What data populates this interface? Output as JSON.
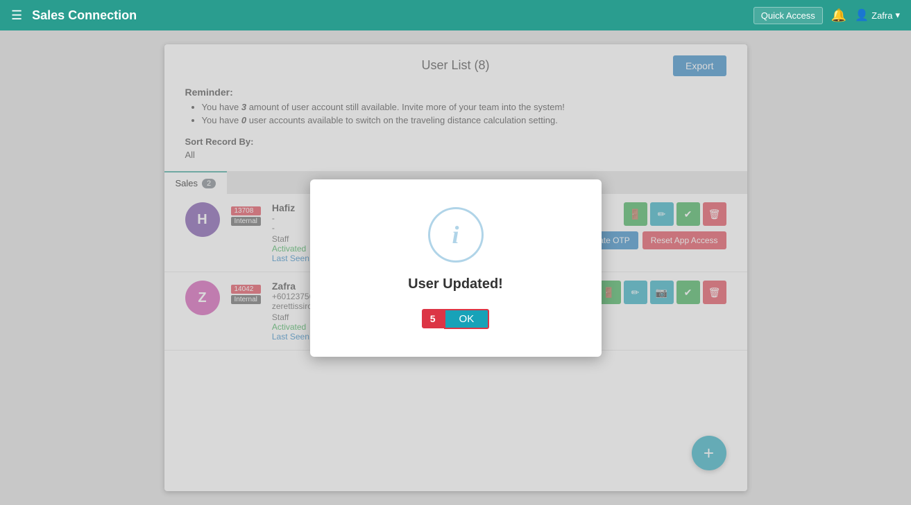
{
  "header": {
    "menu_icon": "☰",
    "title": "Sales Connection",
    "quick_access_label": "Quick Access",
    "bell_icon": "🔔",
    "user_icon": "👤",
    "user_name": "Zafra",
    "chevron_icon": "▾"
  },
  "page": {
    "title": "User List (8)",
    "export_label": "Export"
  },
  "reminder": {
    "title": "Reminder:",
    "lines": [
      "You have 3 amount of user account still available. Invite more of your team into the system!",
      "You have 0 user accounts available to switch on the traveling distance calculation setting."
    ],
    "bold_values": [
      "3",
      "0"
    ]
  },
  "sort": {
    "label": "Sort Record By:",
    "value": "All"
  },
  "tabs": [
    {
      "label": "Sales",
      "badge": "2"
    }
  ],
  "users": [
    {
      "avatar_letter": "H",
      "avatar_color": "purple",
      "name": "Hafiz",
      "phone": "-",
      "email": "-",
      "role": "Staff",
      "status": "Activated",
      "last_seen": "Last Seen: -",
      "id_badge": "13708",
      "type_badge": "Internal",
      "actions": [
        "door",
        "edit",
        "check",
        "delete"
      ],
      "extra_actions": [
        "generate_otp",
        "reset_app"
      ]
    },
    {
      "avatar_letter": "Z",
      "avatar_color": "magenta",
      "name": "Zafra",
      "phone": "+60123756789",
      "email": "zerettissiro-8731@yopmail.com",
      "role": "Staff",
      "status": "Activated",
      "last_seen": "Last Seen: 4 days ago",
      "id_badge": "14042",
      "type_badge": "Internal",
      "actions": [
        "door",
        "edit",
        "camera",
        "check",
        "delete"
      ],
      "extra_actions": []
    }
  ],
  "buttons": {
    "generate_otp": "Generate OTP",
    "reset_app": "Reset App Access",
    "fab_icon": "+"
  },
  "modal": {
    "icon": "i",
    "title": "User Updated!",
    "step_number": "5",
    "ok_label": "OK"
  }
}
